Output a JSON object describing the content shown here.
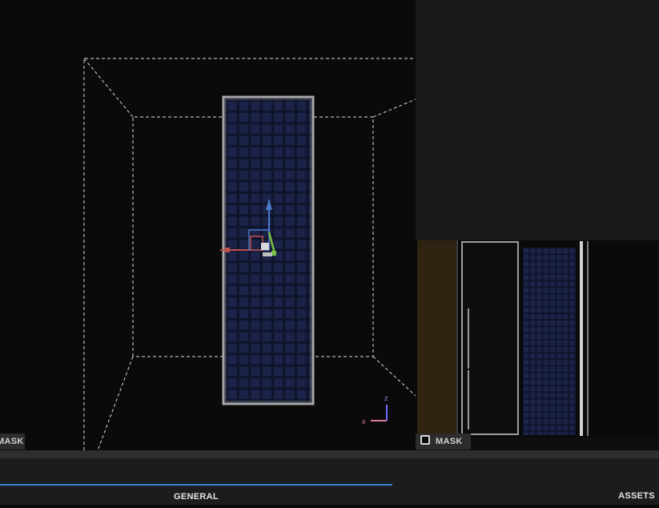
{
  "viewport_left": {
    "mask_label": "MASK",
    "axis_gizmo": {
      "x_label": "x",
      "z_label": "z"
    }
  },
  "viewport_right": {
    "mask_label": "MASK",
    "mask_toggle_icon": "checkbox-square-icon"
  },
  "tabs": {
    "general_label": "GENERAL",
    "assets_label": "ASSETS",
    "active": "GENERAL"
  },
  "colors": {
    "accent": "#3a82d6",
    "viewport_bg": "#0a0a0a",
    "panel_bg": "#181818",
    "mesh_blue": "#1b2348",
    "gizmo_x": "#c0504d",
    "gizmo_y": "#7ac143",
    "gizmo_z": "#4a78c8"
  }
}
